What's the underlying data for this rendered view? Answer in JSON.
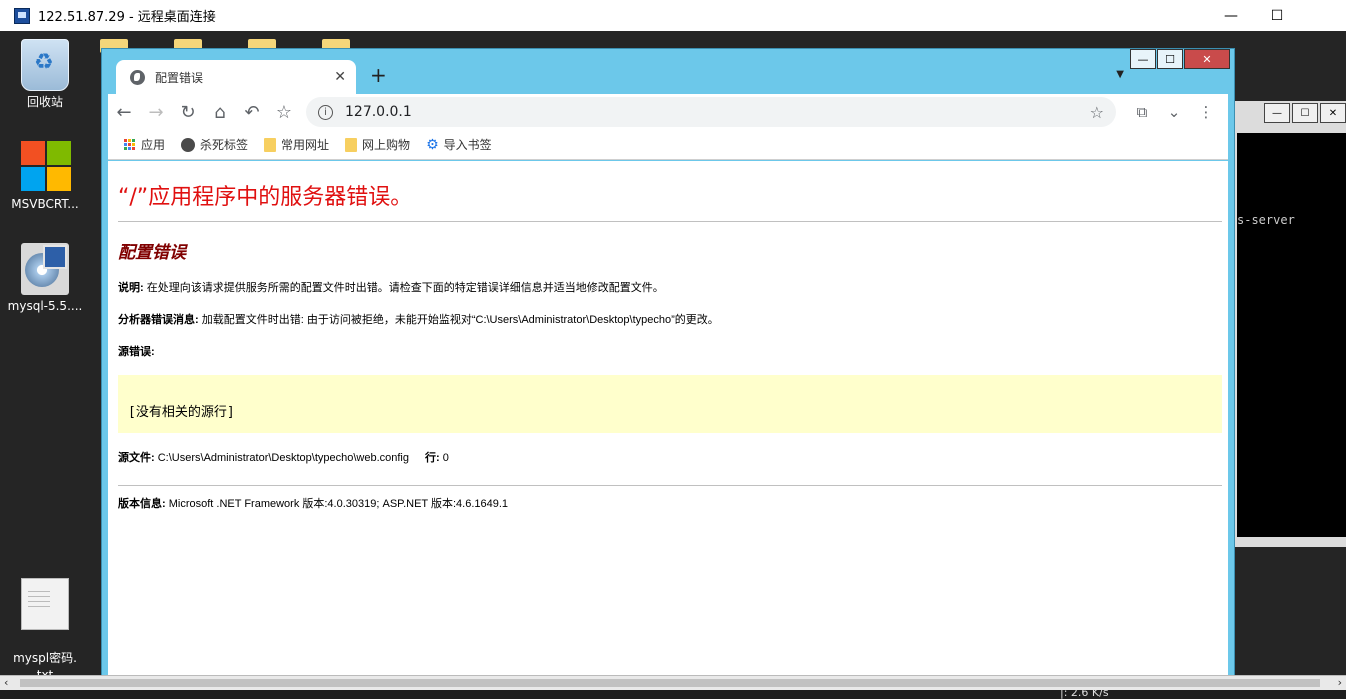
{
  "rdp": {
    "title": "122.51.87.29 - 远程桌面连接",
    "minimize": "—",
    "maximize": "☐"
  },
  "desktop": {
    "icons": [
      {
        "label": "回收站"
      },
      {
        "label": "MSVBCRT..."
      },
      {
        "label": "mysql-5.5...."
      },
      {
        "label": "myspl密码.\ntxt"
      }
    ]
  },
  "console": {
    "text": "s-server",
    "min": "—",
    "max": "☐",
    "close": "✕"
  },
  "browser": {
    "tab_title": "配置错误",
    "tab_close": "✕",
    "new_tab": "+",
    "tab_menu": "▼",
    "win_min": "—",
    "win_max": "☐",
    "win_close": "✕",
    "url": "127.0.0.1",
    "bookmarks": [
      "应用",
      "杀死标签",
      "常用网址",
      "网上购物",
      "导入书签"
    ]
  },
  "page": {
    "title": "“/”应用程序中的服务器错误。",
    "subtitle": "配置错误",
    "desc_label": "说明:",
    "desc_text": " 在处理向该请求提供服务所需的配置文件时出错。请检查下面的特定错误详细信息并适当地修改配置文件。",
    "parser_label": "分析器错误消息:",
    "parser_text": " 加载配置文件时出错: 由于访问被拒绝，未能开始监视对“C:\\Users\\Administrator\\Desktop\\typecho”的更改。",
    "source_label": "源错误:",
    "source_code": "[没有相关的源行]",
    "srcfile_label": "源文件:",
    "srcfile_path": " C:\\Users\\Administrator\\Desktop\\typecho\\web.config",
    "line_label": "行:",
    "line_value": " 0",
    "version_label": "版本信息:",
    "version_text": " Microsoft .NET Framework 版本:4.0.30319; ASP.NET 版本:4.6.1649.1"
  },
  "status": {
    "speed": "|: 2.6 K/s"
  },
  "colors": {
    "error_title": "#e01010",
    "error_subtitle": "#800000",
    "code_background": "#ffffcc",
    "browser_frame": "#6cc8ea"
  }
}
